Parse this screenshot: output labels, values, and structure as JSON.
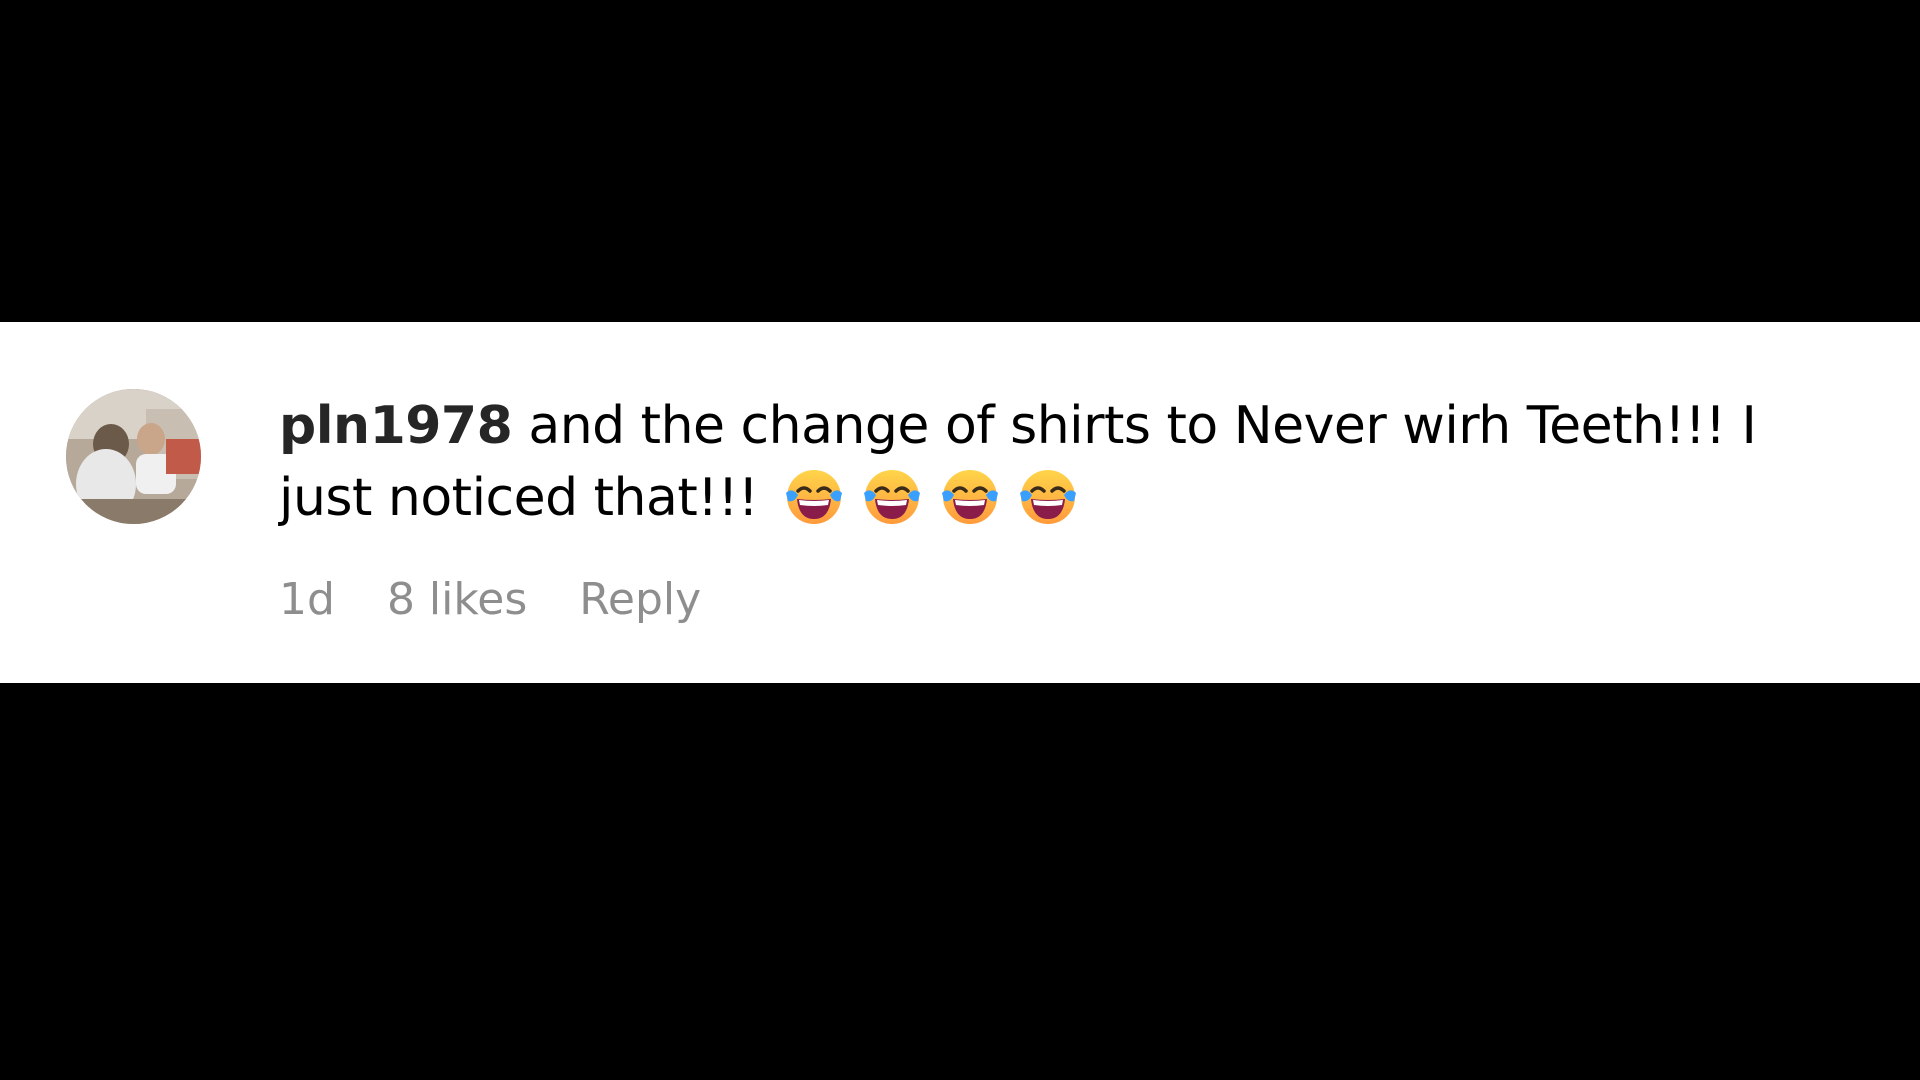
{
  "comment": {
    "username": "pln1978",
    "text": " and the change of shirts to Never wirh Teeth!!! I just noticed that!!!",
    "emojis": [
      "face-with-tears-of-joy",
      "face-with-tears-of-joy",
      "face-with-tears-of-joy",
      "face-with-tears-of-joy"
    ],
    "time": "1d",
    "likes": "8 likes",
    "reply_label": "Reply"
  },
  "colors": {
    "background": "#000000",
    "card": "#ffffff",
    "text": "#000000",
    "meta": "#8e8e8e"
  }
}
